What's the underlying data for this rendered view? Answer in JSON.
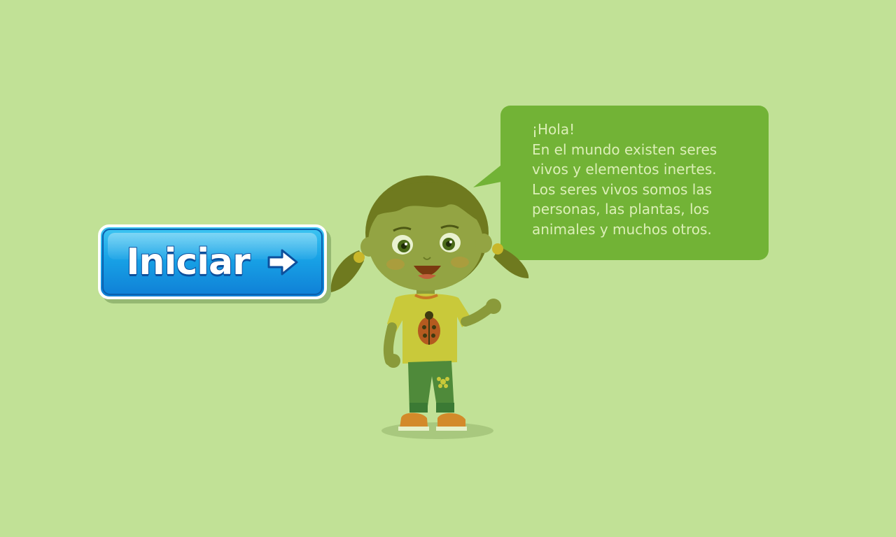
{
  "start_button": {
    "label": "Iniciar",
    "icon": "arrow-right-icon"
  },
  "speech_bubble": {
    "greeting": "¡Hola!",
    "lines": "En el mundo existen  seres\nvivos y elementos inertes.\nLos seres vivos somos las\npersonas, las plantas, los\nanimales y muchos otros."
  },
  "character": {
    "icon": "girl-character-illustration"
  },
  "colors": {
    "background": "#c1e196",
    "bubble": "#72b336",
    "bubble_text": "#dcefb8",
    "button": "#18a2e6",
    "button_text": "#ffffff"
  }
}
